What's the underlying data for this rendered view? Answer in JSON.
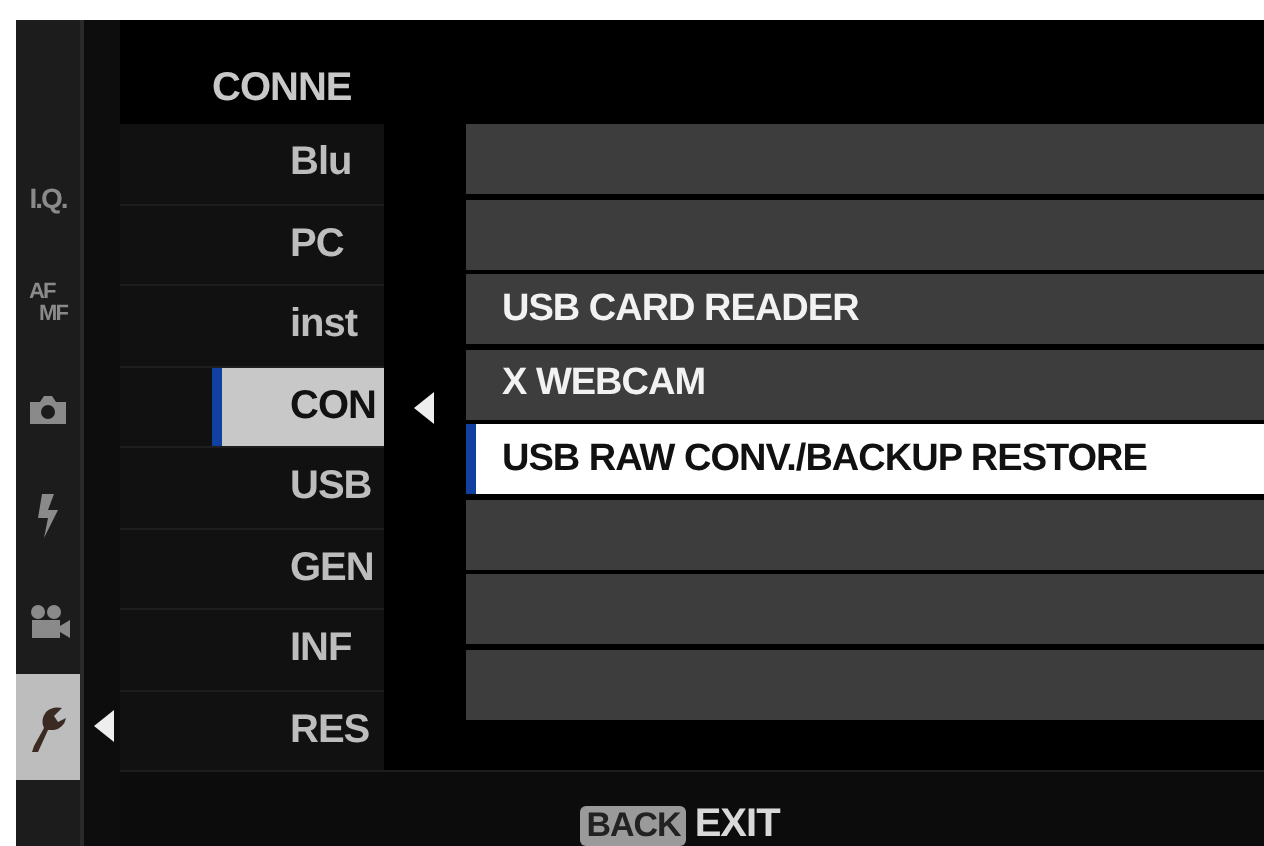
{
  "sidebar": {
    "tabs": [
      {
        "kind": "text",
        "label": "I.Q.",
        "selected": false
      },
      {
        "kind": "stacked",
        "lines": [
          "AF",
          "MF"
        ],
        "selected": false
      },
      {
        "kind": "camera",
        "selected": false
      },
      {
        "kind": "flash",
        "selected": false
      },
      {
        "kind": "movie",
        "selected": false
      },
      {
        "kind": "wrench",
        "selected": true
      }
    ]
  },
  "menu": {
    "title": "CONNE",
    "items": [
      {
        "label": "Blu",
        "selected": false
      },
      {
        "label": "PC",
        "selected": false
      },
      {
        "label": "inst",
        "selected": false
      },
      {
        "label": "CON",
        "selected": true
      },
      {
        "label": "USB",
        "selected": false
      },
      {
        "label": "GEN",
        "selected": false
      },
      {
        "label": "INF",
        "selected": false
      },
      {
        "label": "RES",
        "selected": false
      }
    ]
  },
  "popup": {
    "options": [
      {
        "selected": false
      },
      {
        "selected": false
      },
      {
        "label": "USB CARD READER",
        "selected": false
      },
      {
        "label": "X WEBCAM",
        "selected": false
      },
      {
        "label": "USB RAW CONV./BACKUP RESTORE",
        "selected": true
      },
      {
        "selected": false
      },
      {
        "selected": false
      },
      {
        "selected": false
      }
    ]
  },
  "footer": {
    "button": "BACK",
    "label": "EXIT"
  }
}
